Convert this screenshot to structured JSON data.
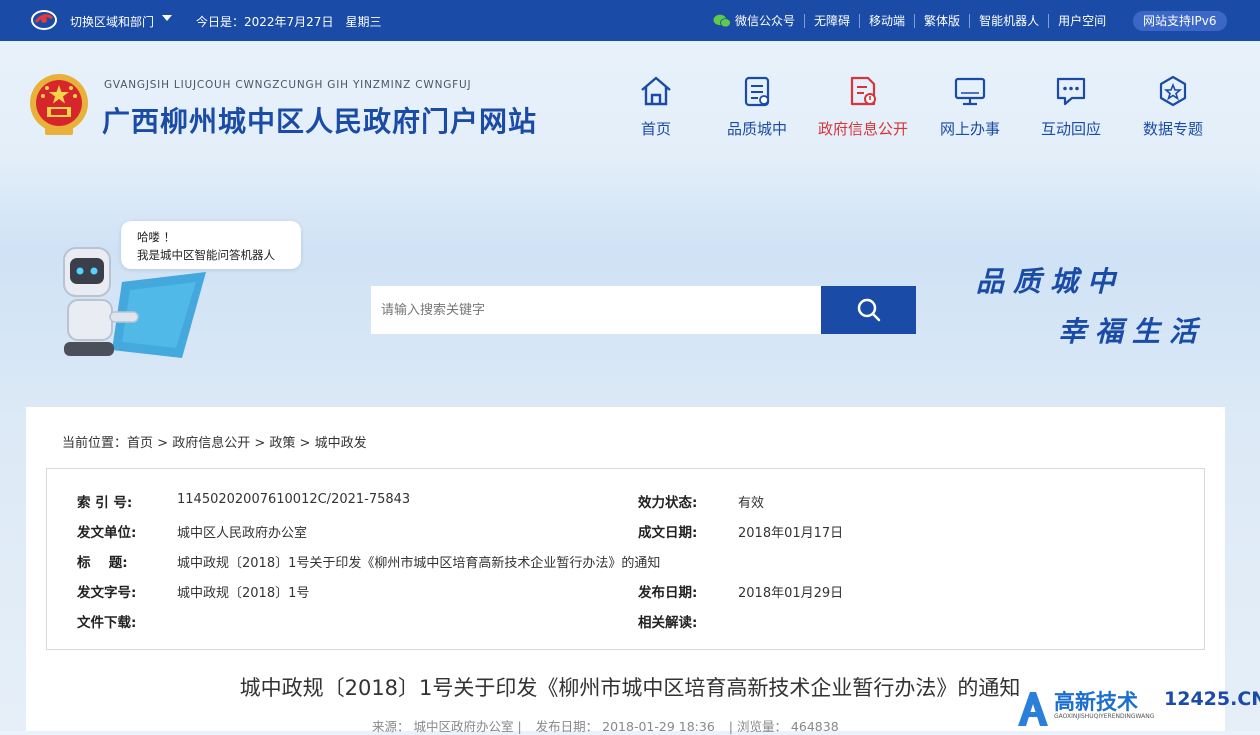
{
  "topbar": {
    "switch_label": "切换区域和部门",
    "date_label": "今日是：2022年7月27日　星期三",
    "links": [
      "微信公众号",
      "无障碍",
      "移动端",
      "繁体版",
      "智能机器人",
      "用户空间"
    ],
    "ipv6": "网站支持IPv6"
  },
  "header": {
    "pinyin": "GVANGJSIH LIUJCOUH CWNGZCUNGH GIH YINZMINZ CWNGFUJ",
    "title": "广西柳州城中区人民政府门户网站",
    "nav": [
      {
        "label": "首页",
        "icon": "home-icon"
      },
      {
        "label": "品质城中",
        "icon": "document-list-icon"
      },
      {
        "label": "政府信息公开",
        "icon": "gov-info-icon"
      },
      {
        "label": "网上办事",
        "icon": "monitor-icon"
      },
      {
        "label": "互动回应",
        "icon": "chat-bubble-icon"
      },
      {
        "label": "数据专题",
        "icon": "badge-star-icon"
      }
    ],
    "active_nav": "政府信息公开"
  },
  "banner": {
    "bubble_line1": "哈喽 ！",
    "bubble_line2": "我是城中区智能问答机器人",
    "search_placeholder": "请输入搜索关键字",
    "slogan_line1": "品质城中",
    "slogan_line2": "幸福生活"
  },
  "breadcrumb": {
    "prefix": "当前位置：",
    "items": [
      "首页",
      "政府信息公开",
      "政策",
      "城中政发"
    ],
    "separator": " > "
  },
  "info": {
    "index_label": "索 引 号:",
    "index_value": "11450202007610012C/2021-75843",
    "status_label": "效力状态:",
    "status_value": "有效",
    "issuer_label": "发文单位:",
    "issuer_value": "城中区人民政府办公室",
    "created_label": "成文日期:",
    "created_value": "2018年01月17日",
    "title_label": "标　 题:",
    "title_value": "城中政规〔2018〕1号关于印发《柳州市城中区培育高新技术企业暂行办法》的通知",
    "docno_label": "发文字号:",
    "docno_value": "城中政规〔2018〕1号",
    "published_label": "发布日期:",
    "published_value": "2018年01月29日",
    "download_label": "文件下载:",
    "interpret_label": "相关解读:"
  },
  "article": {
    "title": "城中政规〔2018〕1号关于印发《柳州市城中区培育高新技术企业暂行办法》的通知",
    "source": "来源：  城中区政府办公室  |",
    "date": "发布日期：  2018-01-29 18:36",
    "views": "|  浏览量：  464838"
  },
  "watermark": {
    "title": "高新技术",
    "url": "12425.CN",
    "sub": "GAOXINJISHUQIYERENDINGWANG"
  },
  "colors": {
    "brand": "#1a4ba6",
    "active": "#d8343a"
  }
}
